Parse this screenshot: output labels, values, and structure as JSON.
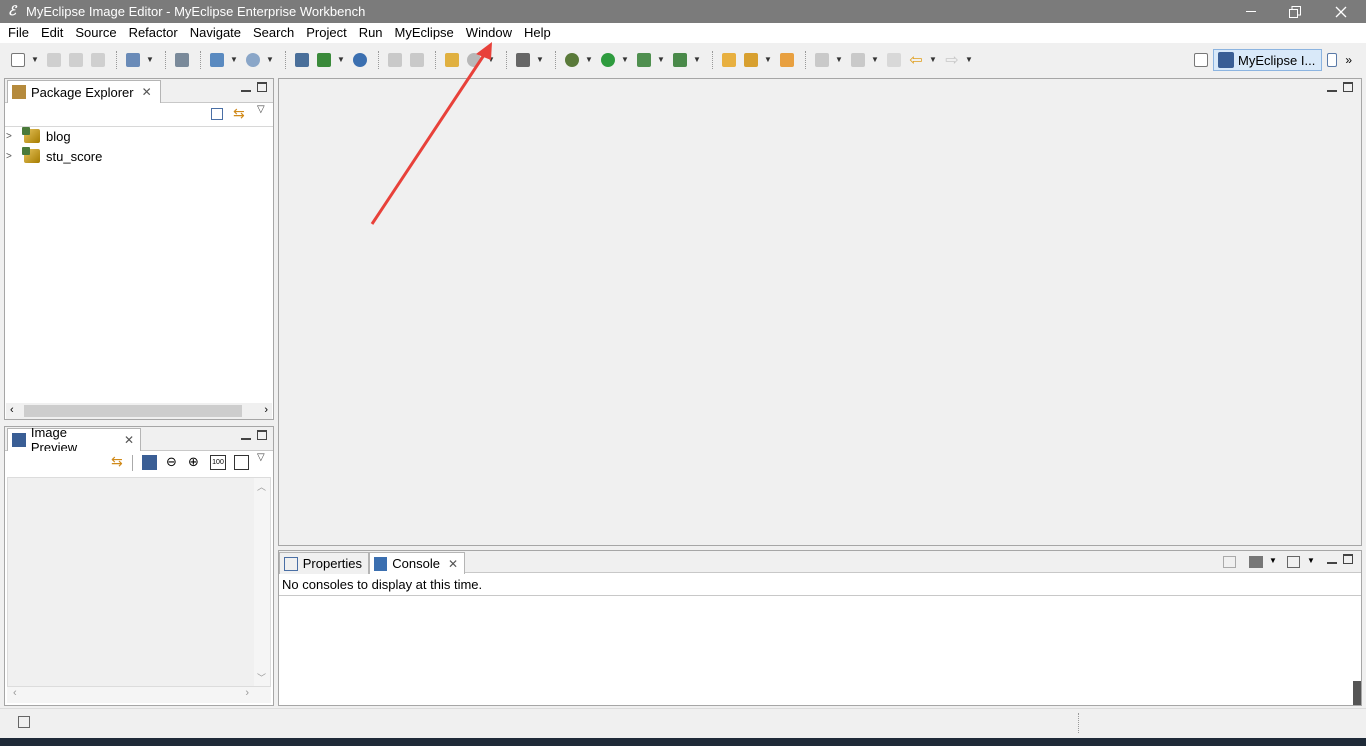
{
  "window": {
    "title": "MyEclipse Image Editor - MyEclipse Enterprise Workbench",
    "app_icon": "myeclipse-logo",
    "controls": [
      "minimize",
      "restore",
      "close"
    ]
  },
  "menubar": {
    "items": [
      "File",
      "Edit",
      "Source",
      "Refactor",
      "Navigate",
      "Search",
      "Project",
      "Run",
      "MyEclipse",
      "Window",
      "Help"
    ]
  },
  "perspective": {
    "active_label": "MyEclipse I...",
    "overflow": "»"
  },
  "package_explorer": {
    "tab_label": "Package Explorer",
    "projects": [
      {
        "name": "blog",
        "expanded": false
      },
      {
        "name": "stu_score",
        "expanded": false
      }
    ]
  },
  "image_preview": {
    "tab_label": "Image Preview"
  },
  "bottom_panel": {
    "tabs": [
      {
        "label": "Properties",
        "active": false
      },
      {
        "label": "Console",
        "active": true
      }
    ],
    "console_message": "No consoles to display at this time."
  },
  "colors": {
    "titlebar_bg": "#7b7b7b",
    "annotation_arrow": "#e8413a",
    "panel_border": "#a6a6a6"
  }
}
